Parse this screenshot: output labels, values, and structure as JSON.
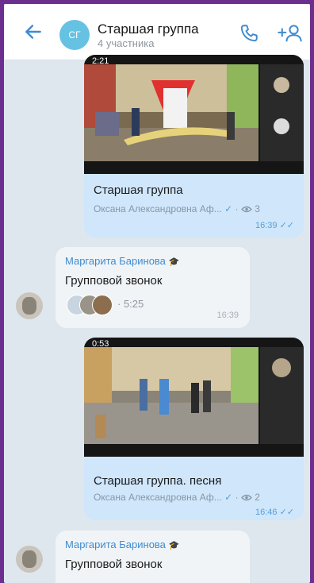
{
  "header": {
    "avatar_initials": "СГ",
    "title": "Старшая группа",
    "subtitle": "4 участника",
    "icons": [
      "arrow-left-icon",
      "phone-icon",
      "add-user-icon"
    ]
  },
  "messages": [
    {
      "type": "video",
      "duration": "2:21",
      "caption": "Старшая группа",
      "author": "Оксана Александровна Аф...",
      "views": "3",
      "time": "16:39"
    },
    {
      "type": "call",
      "sender": "Маргарита Баринова",
      "text": "Групповой звонок",
      "call_duration": "5:25",
      "time": "16:39"
    },
    {
      "type": "video",
      "duration": "0:53",
      "caption": "Старшая группа. песня",
      "author": "Оксана Александровна Аф...",
      "views": "2",
      "time": "16:46"
    },
    {
      "type": "call",
      "sender": "Маргарита Баринова",
      "text": "Групповой звонок"
    }
  ],
  "colors": {
    "accent": "#3e8bd0",
    "outgoing_bubble": "#cfe6fb",
    "incoming_bubble": "#f1f4f7",
    "chat_background": "#dfe7ee"
  }
}
